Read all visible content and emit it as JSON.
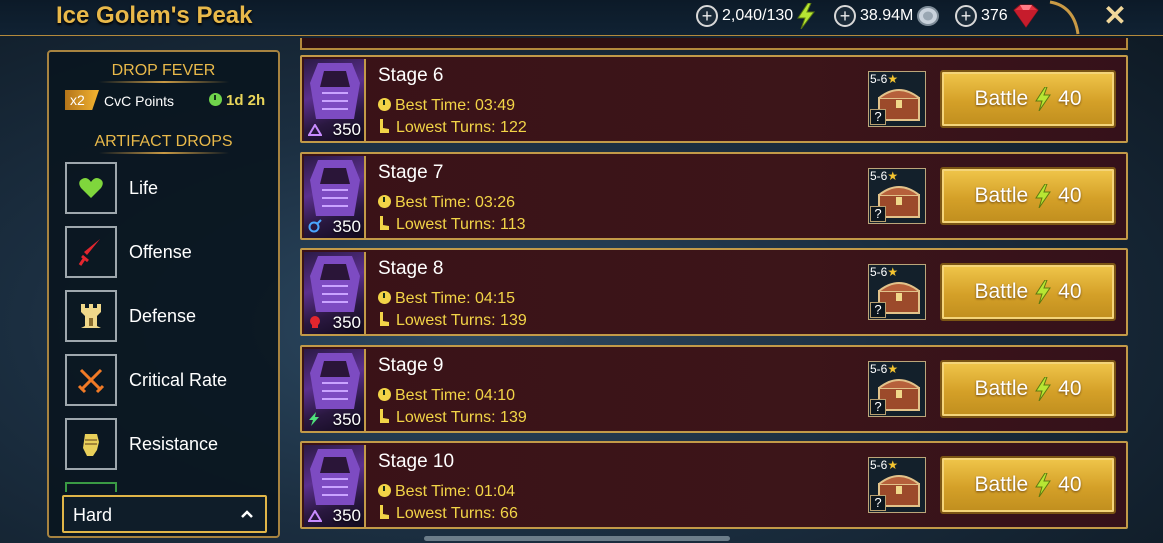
{
  "header": {
    "title": "Ice Golem's Peak",
    "energy": "2,040/130",
    "silver": "38.94M",
    "gems": "376"
  },
  "drop_fever": {
    "title": "DROP FEVER",
    "multiplier": "x2",
    "label": "CvC Points",
    "timer": "1d 2h"
  },
  "artifact_drops": {
    "title": "ARTIFACT DROPS",
    "items": [
      {
        "label": "Life",
        "icon": "heart-icon"
      },
      {
        "label": "Offense",
        "icon": "sword-icon"
      },
      {
        "label": "Defense",
        "icon": "tower-icon"
      },
      {
        "label": "Critical Rate",
        "icon": "crossed-swords-icon"
      },
      {
        "label": "Resistance",
        "icon": "fist-icon"
      }
    ]
  },
  "difficulty": {
    "selected": "Hard"
  },
  "stages": [
    {
      "name": "Stage 6",
      "level": "350",
      "affinity": "void",
      "best_time_label": "Best Time: 03:49",
      "turns_label": "Lowest Turns: 122",
      "rarity": "5-6",
      "battle_label": "Battle",
      "cost": "40"
    },
    {
      "name": "Stage 7",
      "level": "350",
      "affinity": "magic",
      "best_time_label": "Best Time: 03:26",
      "turns_label": "Lowest Turns: 113",
      "rarity": "5-6",
      "battle_label": "Battle",
      "cost": "40"
    },
    {
      "name": "Stage 8",
      "level": "350",
      "affinity": "force",
      "best_time_label": "Best Time: 04:15",
      "turns_label": "Lowest Turns: 139",
      "rarity": "5-6",
      "battle_label": "Battle",
      "cost": "40"
    },
    {
      "name": "Stage 9",
      "level": "350",
      "affinity": "spirit",
      "best_time_label": "Best Time: 04:10",
      "turns_label": "Lowest Turns: 139",
      "rarity": "5-6",
      "battle_label": "Battle",
      "cost": "40"
    },
    {
      "name": "Stage 10",
      "level": "350",
      "affinity": "void",
      "best_time_label": "Best Time: 01:04",
      "turns_label": "Lowest Turns: 66",
      "rarity": "5-6",
      "battle_label": "Battle",
      "cost": "40"
    }
  ],
  "colors": {
    "gold": "#e9b94a",
    "stat_yellow": "#f2d447",
    "row_bg": "#3a1217",
    "button": "#d4a028"
  }
}
